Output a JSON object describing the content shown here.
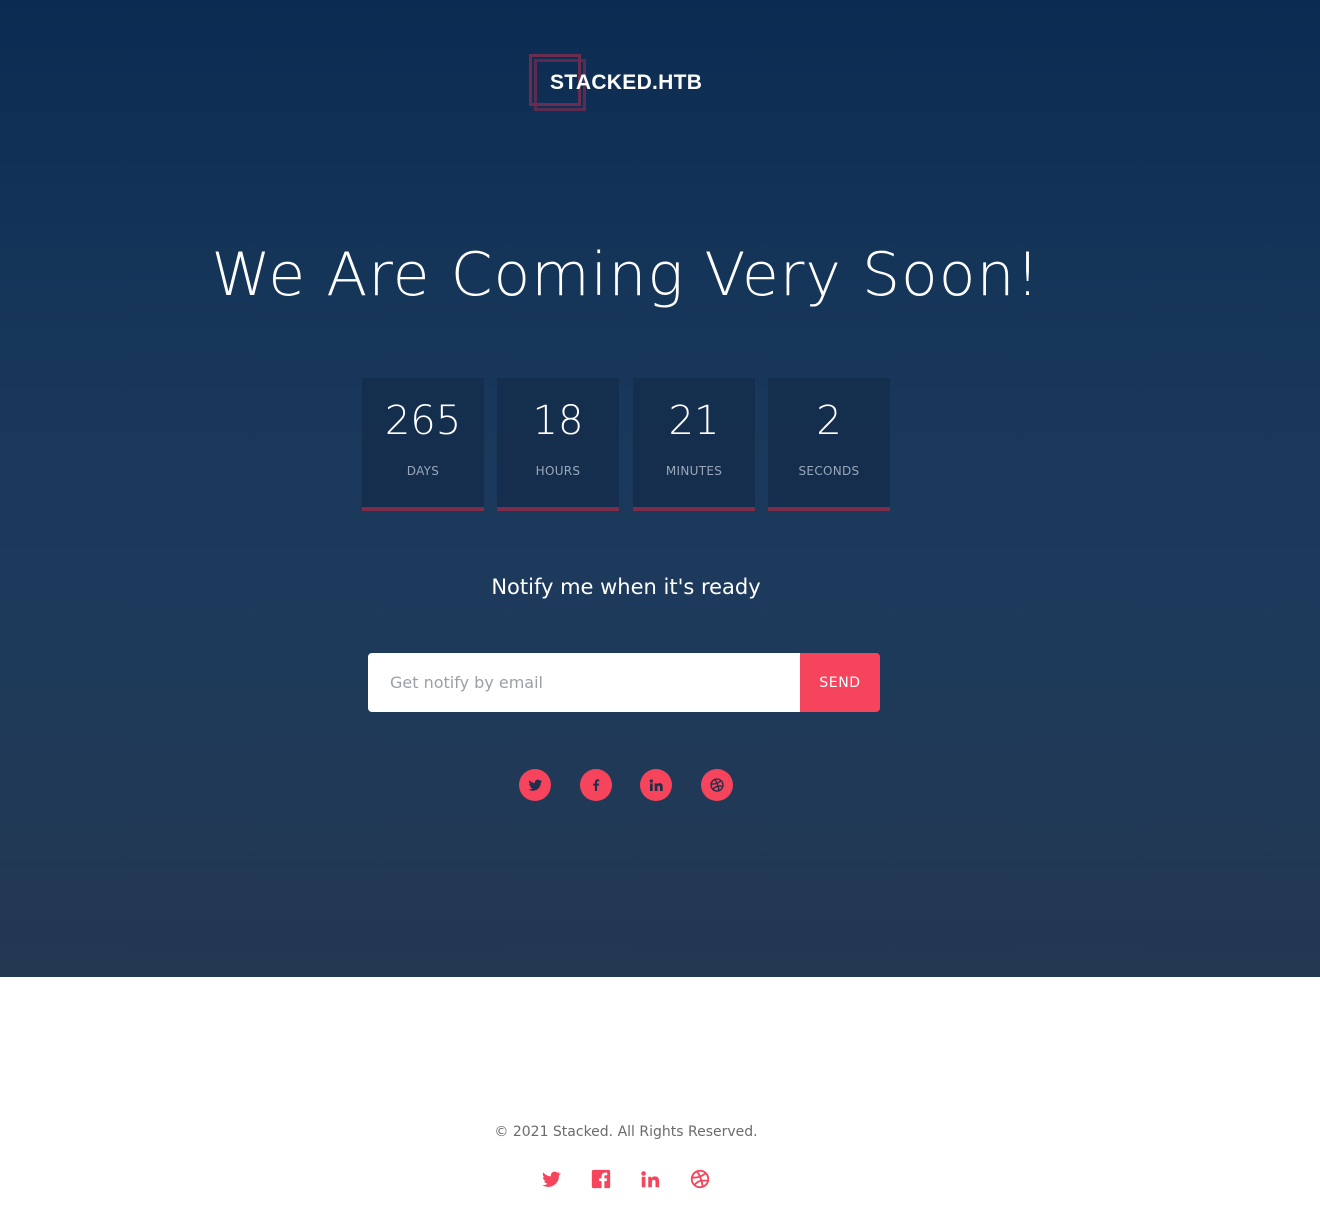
{
  "brand": {
    "name": "STACKED.HTB"
  },
  "hero": {
    "headline": "We Are Coming Very Soon!"
  },
  "countdown": [
    {
      "value": "265",
      "label": "DAYS"
    },
    {
      "value": "18",
      "label": "HOURS"
    },
    {
      "value": "21",
      "label": "MINUTES"
    },
    {
      "value": "2",
      "label": "SECONDS"
    }
  ],
  "notify": {
    "title": "Notify me when it's ready",
    "email_placeholder": "Get notify by email",
    "email_value": "",
    "send_label": "SEND"
  },
  "social": [
    "twitter-icon",
    "facebook-icon",
    "linkedin-icon",
    "dribbble-icon"
  ],
  "footer": {
    "copyright": "© 2021 Stacked. All Rights Reserved."
  },
  "colors": {
    "accent": "#f5445b",
    "hero_top": "#0b2b52",
    "hero_bottom": "#233851",
    "underline": "#7d2c4a"
  }
}
